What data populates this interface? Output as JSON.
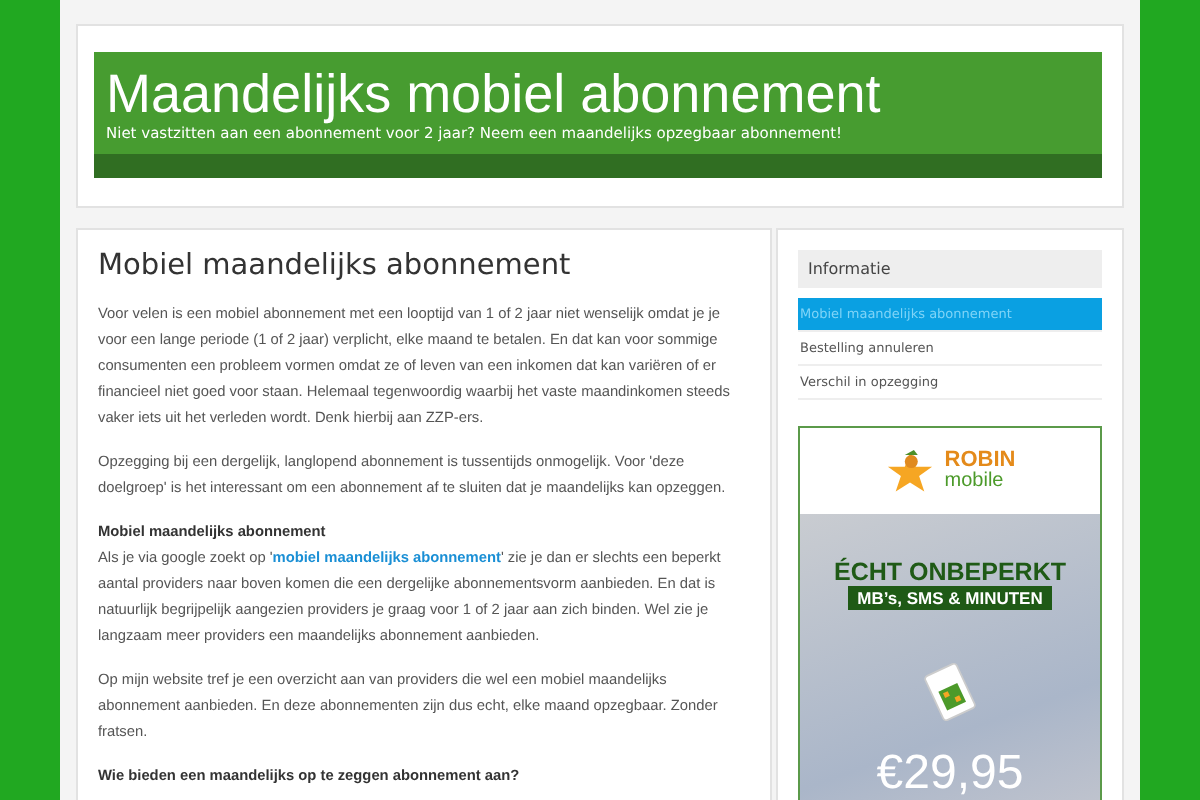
{
  "header": {
    "title": "Maandelijks mobiel abonnement",
    "tagline": "Niet vastzitten aan een abonnement voor 2 jaar? Neem een maandelijks opzegbaar abonnement!"
  },
  "article": {
    "title": "Mobiel maandelijks abonnement",
    "blocks": [
      {
        "kind": "paragraph",
        "text": "Voor velen is een mobiel abonnement met een looptijd van 1 of 2 jaar niet wenselijk omdat je je voor een lange periode (1 of 2 jaar) verplicht, elke maand te betalen. En dat kan voor sommige consumenten een probleem vormen omdat ze of leven van een inkomen dat kan variëren of er financieel niet goed voor staan. Helemaal tegenwoordig waarbij het vaste maandinkomen steeds vaker iets uit het verleden wordt. Denk hierbij aan ZZP-ers."
      },
      {
        "kind": "paragraph",
        "text": "Opzegging bij een dergelijk, langlopend abonnement is tussentijds onmogelijk. Voor 'deze doelgroep' is het interessant om een abonnement af te sluiten dat je maandelijks kan opzeggen."
      },
      {
        "kind": "heading",
        "text": "Mobiel maandelijks abonnement"
      },
      {
        "kind": "link_paragraph",
        "before": "Als je via google zoekt op '",
        "link": "mobiel maandelijks abonnement",
        "after": "' zie je dan er slechts een beperkt aantal providers naar boven komen die een dergelijke abonnementsvorm aanbieden. En dat is natuurlijk begrijpelijk aangezien providers je graag voor 1 of 2 jaar aan zich binden. Wel zie je langzaam meer providers een maandelijks abonnement aanbieden."
      },
      {
        "kind": "paragraph",
        "text": "Op mijn website tref je een overzicht aan van providers die wel een mobiel maandelijks abonnement aanbieden. En deze abonnementen zijn dus echt, elke maand opzegbaar. Zonder fratsen."
      },
      {
        "kind": "heading_gap",
        "text": "Wie bieden een maandelijks op te zeggen abonnement aan?"
      }
    ]
  },
  "sidebar": {
    "title": "Informatie",
    "items": [
      {
        "label": "Mobiel maandelijks abonnement",
        "selected": true
      },
      {
        "label": "Bestelling annuleren",
        "selected": false
      },
      {
        "label": "Verschil in opzegging",
        "selected": false
      }
    ],
    "ad": {
      "brand": "ROBIN",
      "brand_sub": "mobile",
      "headline": "ÉCHT ONBEPERKT",
      "subline": "MB’s, SMS & MINUTEN",
      "price": "€29,95"
    }
  }
}
